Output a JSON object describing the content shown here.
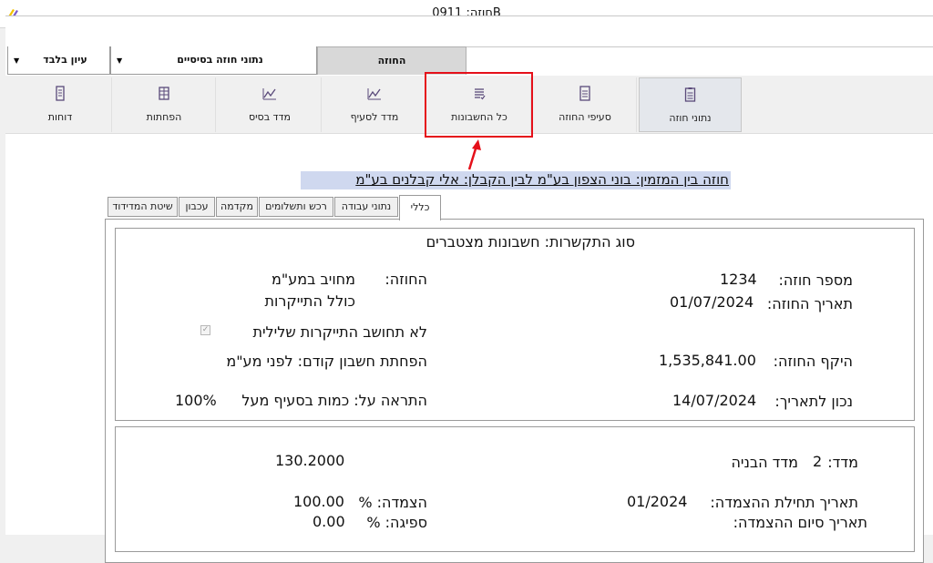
{
  "window": {
    "title": "חוזה: 0911B"
  },
  "top_bar": {
    "view_only": "עיון בלבד",
    "basic_data": "נתוני חוזה בסיסיים",
    "contract_tab": "החוזה"
  },
  "ribbon": {
    "contract_data": "נתוני חוזה",
    "contract_sections": "סעיפי החוזה",
    "all_accounts": "כל החשבונות",
    "section_index": "מדד לסעיף",
    "base_index": "מדד בסיס",
    "deductions": "הפחתות",
    "reports": "דוחות"
  },
  "contract_title": "חוזה בין המזמין: בוני הצפון בע\"מ  לבין הקבלן: אלי קבלנים בע\"מ",
  "sub_tabs": {
    "general": "כללי",
    "work_data": "נתוני עבודה",
    "purchase_payments": "רכש ותשלומים",
    "advance": "מקדמה",
    "retention": "עכבון",
    "measurement_method": "שיטת המדידוד"
  },
  "general": {
    "link_type": "סוג התקשרות: חשבונות מצטברים",
    "contract_number_label": "מספר חוזה:",
    "contract_number": "1234",
    "contract_date_label": "תאריך החוזה:",
    "contract_date": "01/07/2024",
    "contract_scope_label": "היקף החוזה:",
    "contract_scope": "1,535,841.00",
    "as_of_label": "נכון לתאריך:",
    "as_of_date": "14/07/2024",
    "vat_label": "החוזה:",
    "vat_value": "מחויב במע\"מ",
    "price_increase": "כולל התייקרות",
    "negative_increase": "לא תחושב התייקרות שלילית",
    "prev_deduction": "הפחתת חשבון קודם: לפני מע\"מ",
    "alert": "התראה על: כמות בסעיף מעל",
    "alert_percent": "100%"
  },
  "index": {
    "index_label": "מדד:",
    "index_num": "2",
    "index_name": "מדד הבניה",
    "index_value": "130.2000",
    "link_start_label": "תאריך תחילת ההצמדה:",
    "link_start": "01/2024",
    "link_end_label": "תאריך  סיום ההצמדה:",
    "linkage_label": "הצמדה: %",
    "linkage_value": "100.00",
    "absorption_label": "ספיגה: %",
    "absorption_value": "0.00"
  },
  "icons": {
    "app": "app-logo-icon",
    "contract_data": "clipboard-icon",
    "contract_sections": "document-list-icon",
    "all_accounts": "list-check-icon",
    "section_index": "chart-line-icon",
    "base_index": "chart-line-icon",
    "deductions": "table-icon",
    "reports": "reports-icon"
  },
  "colors": {
    "highlight": "#e5101a",
    "title_bg": "#cfd8ef",
    "icon": "#5a4a7a"
  }
}
